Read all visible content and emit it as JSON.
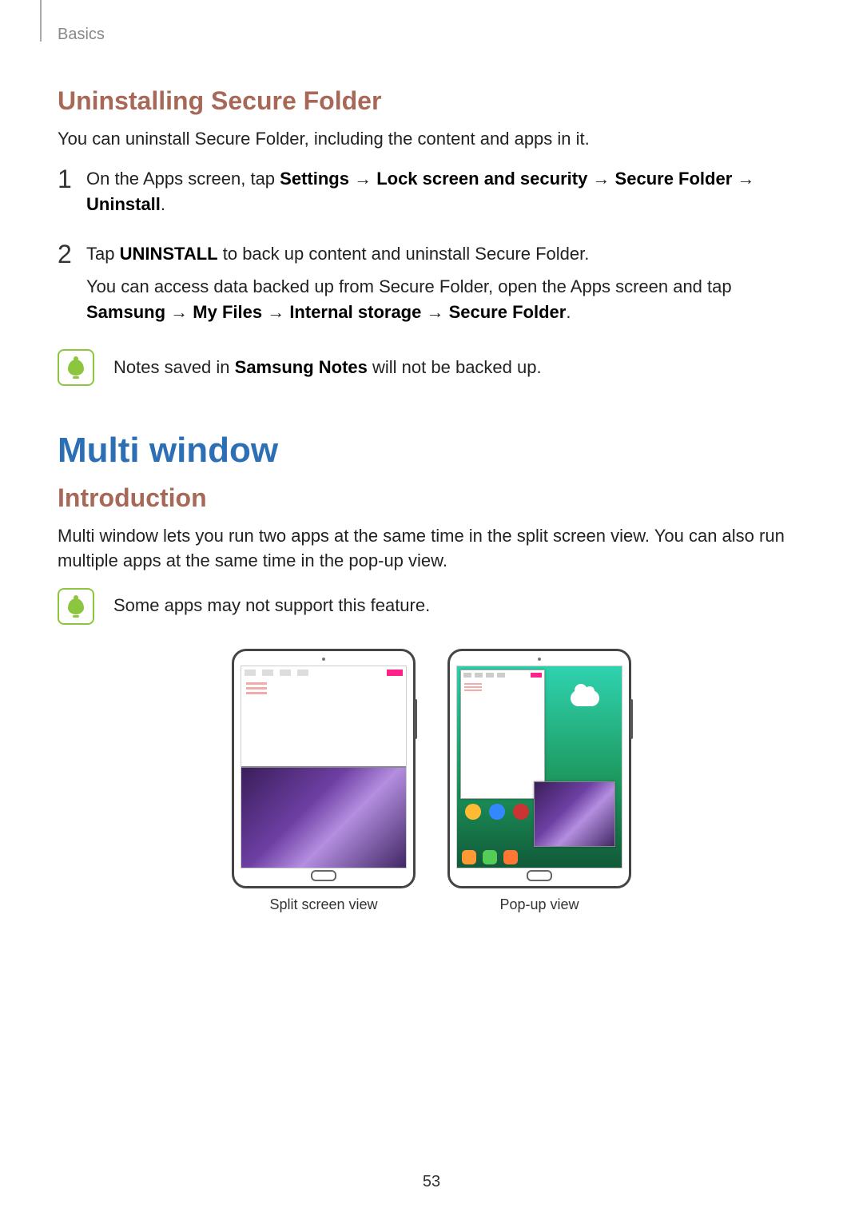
{
  "breadcrumb": "Basics",
  "section1": {
    "title": "Uninstalling Secure Folder",
    "intro": "You can uninstall Secure Folder, including the content and apps in it.",
    "step1": {
      "num": "1",
      "prefix": "On the Apps screen, tap ",
      "b1": "Settings",
      "arrow1": " → ",
      "b2": "Lock screen and security",
      "arrow2": " → ",
      "b3": "Secure Folder",
      "arrow3": " → ",
      "b4": "Uninstall",
      "suffix": "."
    },
    "step2": {
      "num": "2",
      "line1_prefix": "Tap ",
      "line1_b": "UNINSTALL",
      "line1_suffix": " to back up content and uninstall Secure Folder.",
      "line2": "You can access data backed up from Secure Folder, open the Apps screen and tap ",
      "path_b1": "Samsung",
      "path_arr1": " → ",
      "path_b2": "My Files",
      "path_arr2": " → ",
      "path_b3": "Internal storage",
      "path_arr3": " → ",
      "path_b4": "Secure Folder",
      "path_suffix": "."
    },
    "note": {
      "prefix": "Notes saved in ",
      "bold": "Samsung Notes",
      "suffix": " will not be backed up."
    }
  },
  "section2": {
    "title": "Multi window",
    "subtitle": "Introduction",
    "intro": "Multi window lets you run two apps at the same time in the split screen view. You can also run multiple apps at the same time in the pop-up view.",
    "note": "Some apps may not support this feature.",
    "fig1_caption": "Split screen view",
    "fig2_caption": "Pop-up view"
  },
  "page_number": "53"
}
